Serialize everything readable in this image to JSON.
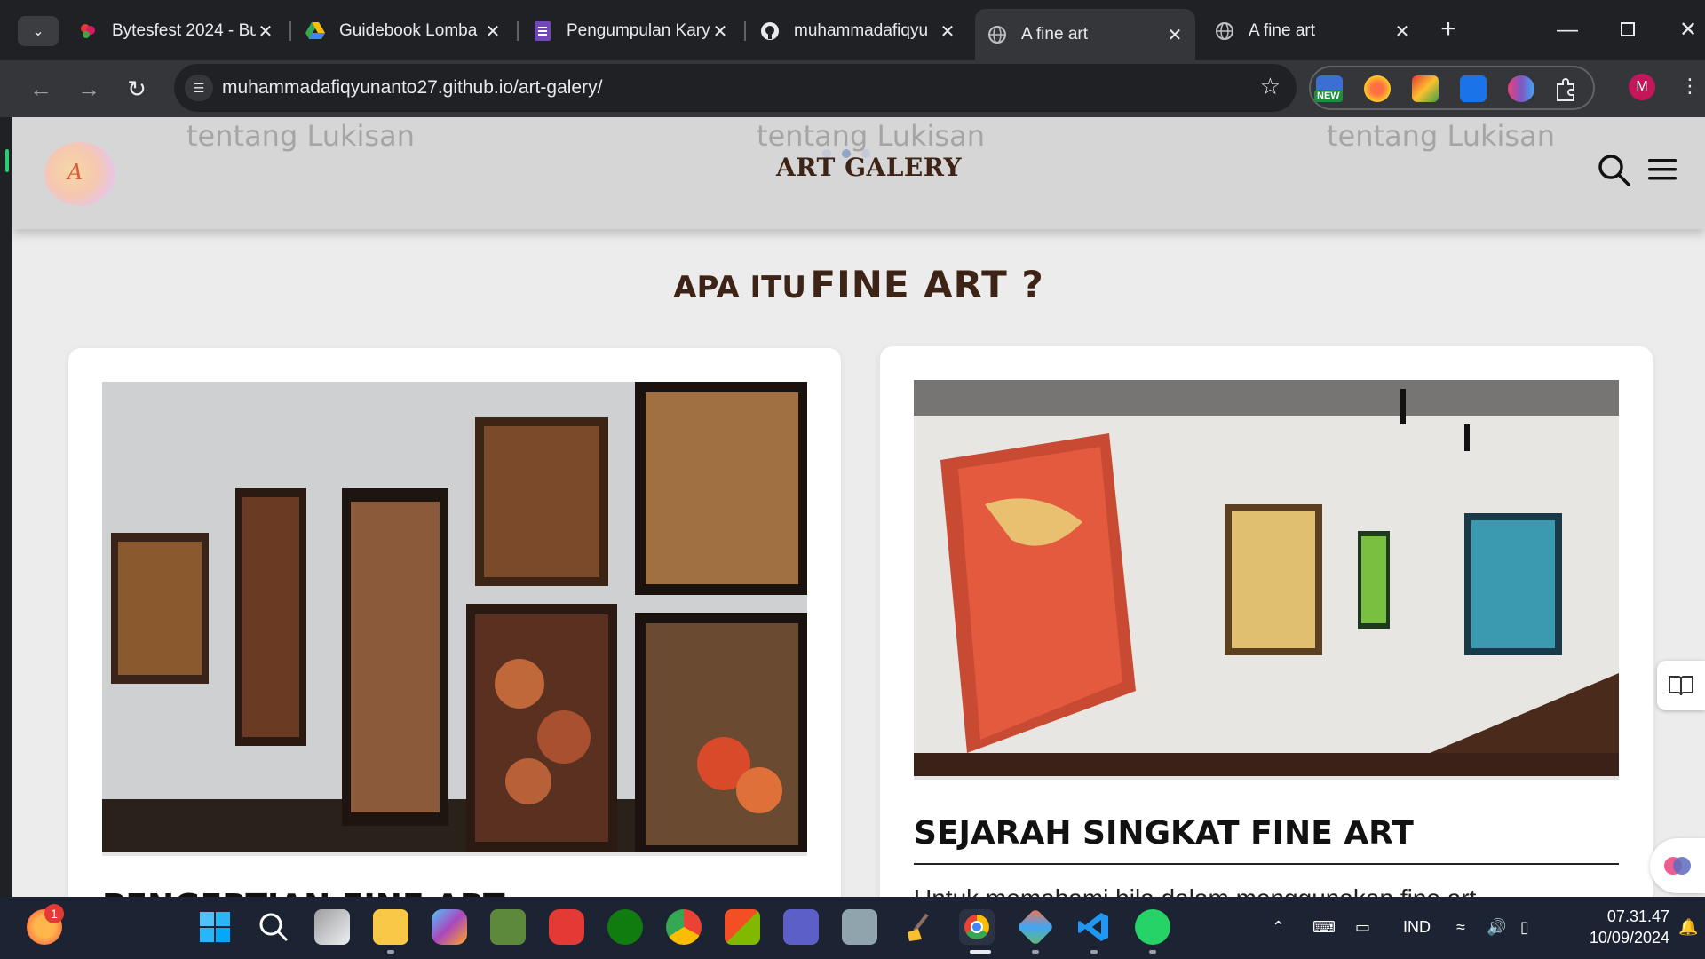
{
  "browser": {
    "tabs": [
      {
        "title": "Bytesfest 2024 - Bu",
        "icon": "bytesfest-icon",
        "active": false
      },
      {
        "title": "Guidebook Lomba",
        "icon": "google-drive-icon",
        "active": false
      },
      {
        "title": "Pengumpulan Kary",
        "icon": "google-forms-icon",
        "active": false
      },
      {
        "title": "muhammadafiqyu",
        "icon": "github-icon",
        "active": false
      },
      {
        "title": "A fine art",
        "icon": "globe-icon",
        "active": true
      },
      {
        "title": "A fine art",
        "icon": "globe-icon",
        "active": false
      }
    ],
    "url": "muhammadafiqyunanto27.github.io/art-galery/",
    "extension_badge": "NEW",
    "profile_initial": "M"
  },
  "site": {
    "ghost_text": "tentang Lukisan",
    "logo_letter": "A",
    "brand": "ART GALERY",
    "section_title_prefix": "APA ITU",
    "section_title_emph": "FINE ART ?",
    "cards": [
      {
        "heading": "PENGERTIAN FINE ART",
        "body": ""
      },
      {
        "heading": "SEJARAH SINGKAT FINE ART",
        "body": "Untuk memahami bila dalam menggunakan fine art"
      }
    ]
  },
  "taskbar": {
    "notification_count": "1",
    "language": "IND",
    "time": "07.31.47",
    "date": "10/09/2024"
  },
  "colors": {
    "brand_brown": "#3d2416",
    "page_bg": "#ececec",
    "header_bg": "#d6d6d6",
    "chrome_dark": "#202124",
    "taskbar_bg": "#1c2332"
  }
}
